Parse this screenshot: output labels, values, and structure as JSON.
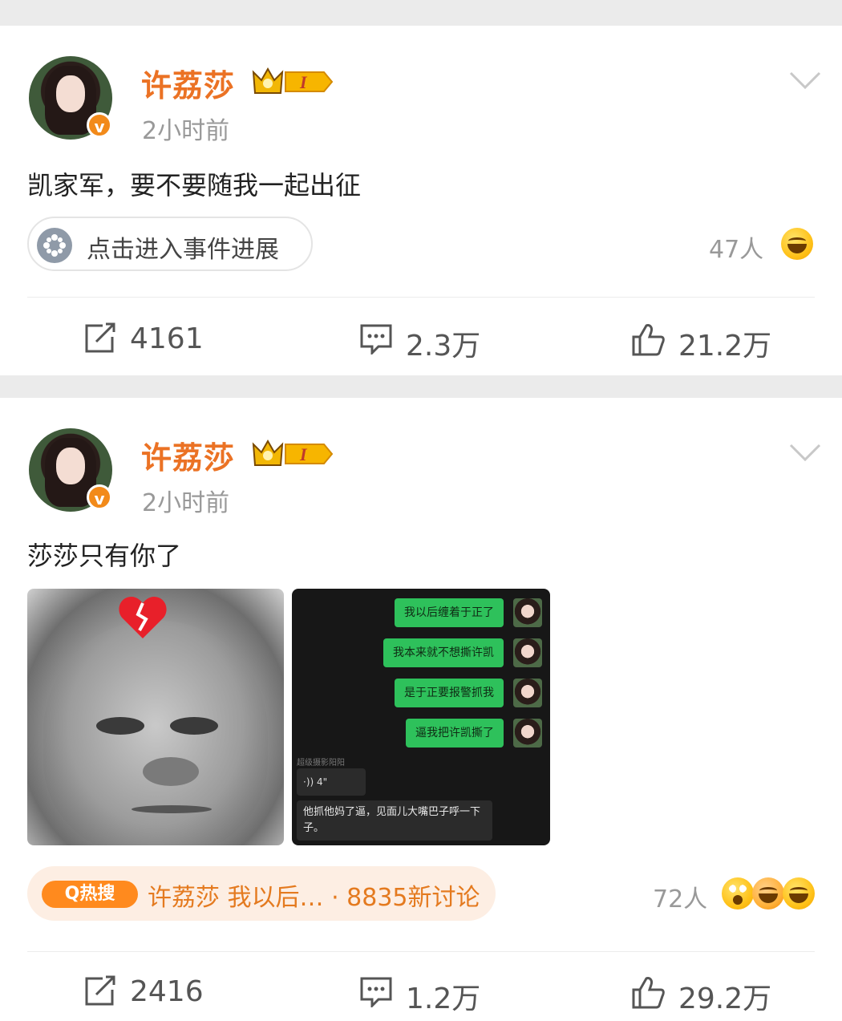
{
  "posts": [
    {
      "username": "许荔莎",
      "level": "I",
      "time": "2小时前",
      "text": "凯家军，要不要随我一起出征",
      "topic_label": "点击进入事件进展",
      "reactions_count": "47人",
      "reposts": "4161",
      "comments": "2.3万",
      "likes": "21.2万"
    },
    {
      "username": "许荔莎",
      "level": "I",
      "time": "2小时前",
      "text": "莎莎只有你了",
      "chat": {
        "out_messages": [
          "我以后缠着于正了",
          "我本来就不想撕许凯",
          "是于正要报警抓我",
          "逼我把许凯撕了"
        ],
        "sender_label": "超级摄影阳阳",
        "voice": "·)) 4\"",
        "in_message": "他抓他妈了逼，见面儿大嘴巴子呼一下子。"
      },
      "hot_search": {
        "tag": "Q热搜",
        "text": "许荔莎 我以后… · 8835新讨论"
      },
      "reactions_count": "72人",
      "reposts": "2416",
      "comments": "1.2万",
      "likes": "29.2万"
    }
  ],
  "colors": {
    "username": "#eb7224",
    "hot_pill_bg": "#fdeee3",
    "hot_tag": "#ff8a1e",
    "chat_bubble": "#2ec15b"
  },
  "icons": [
    "crown-badge-icon",
    "verified-icon",
    "chevron-down-icon",
    "topic-icon",
    "laugh-emoji-icon",
    "surprised-emoji-icon",
    "repost-icon",
    "comment-icon",
    "like-icon",
    "broken-heart-icon"
  ]
}
